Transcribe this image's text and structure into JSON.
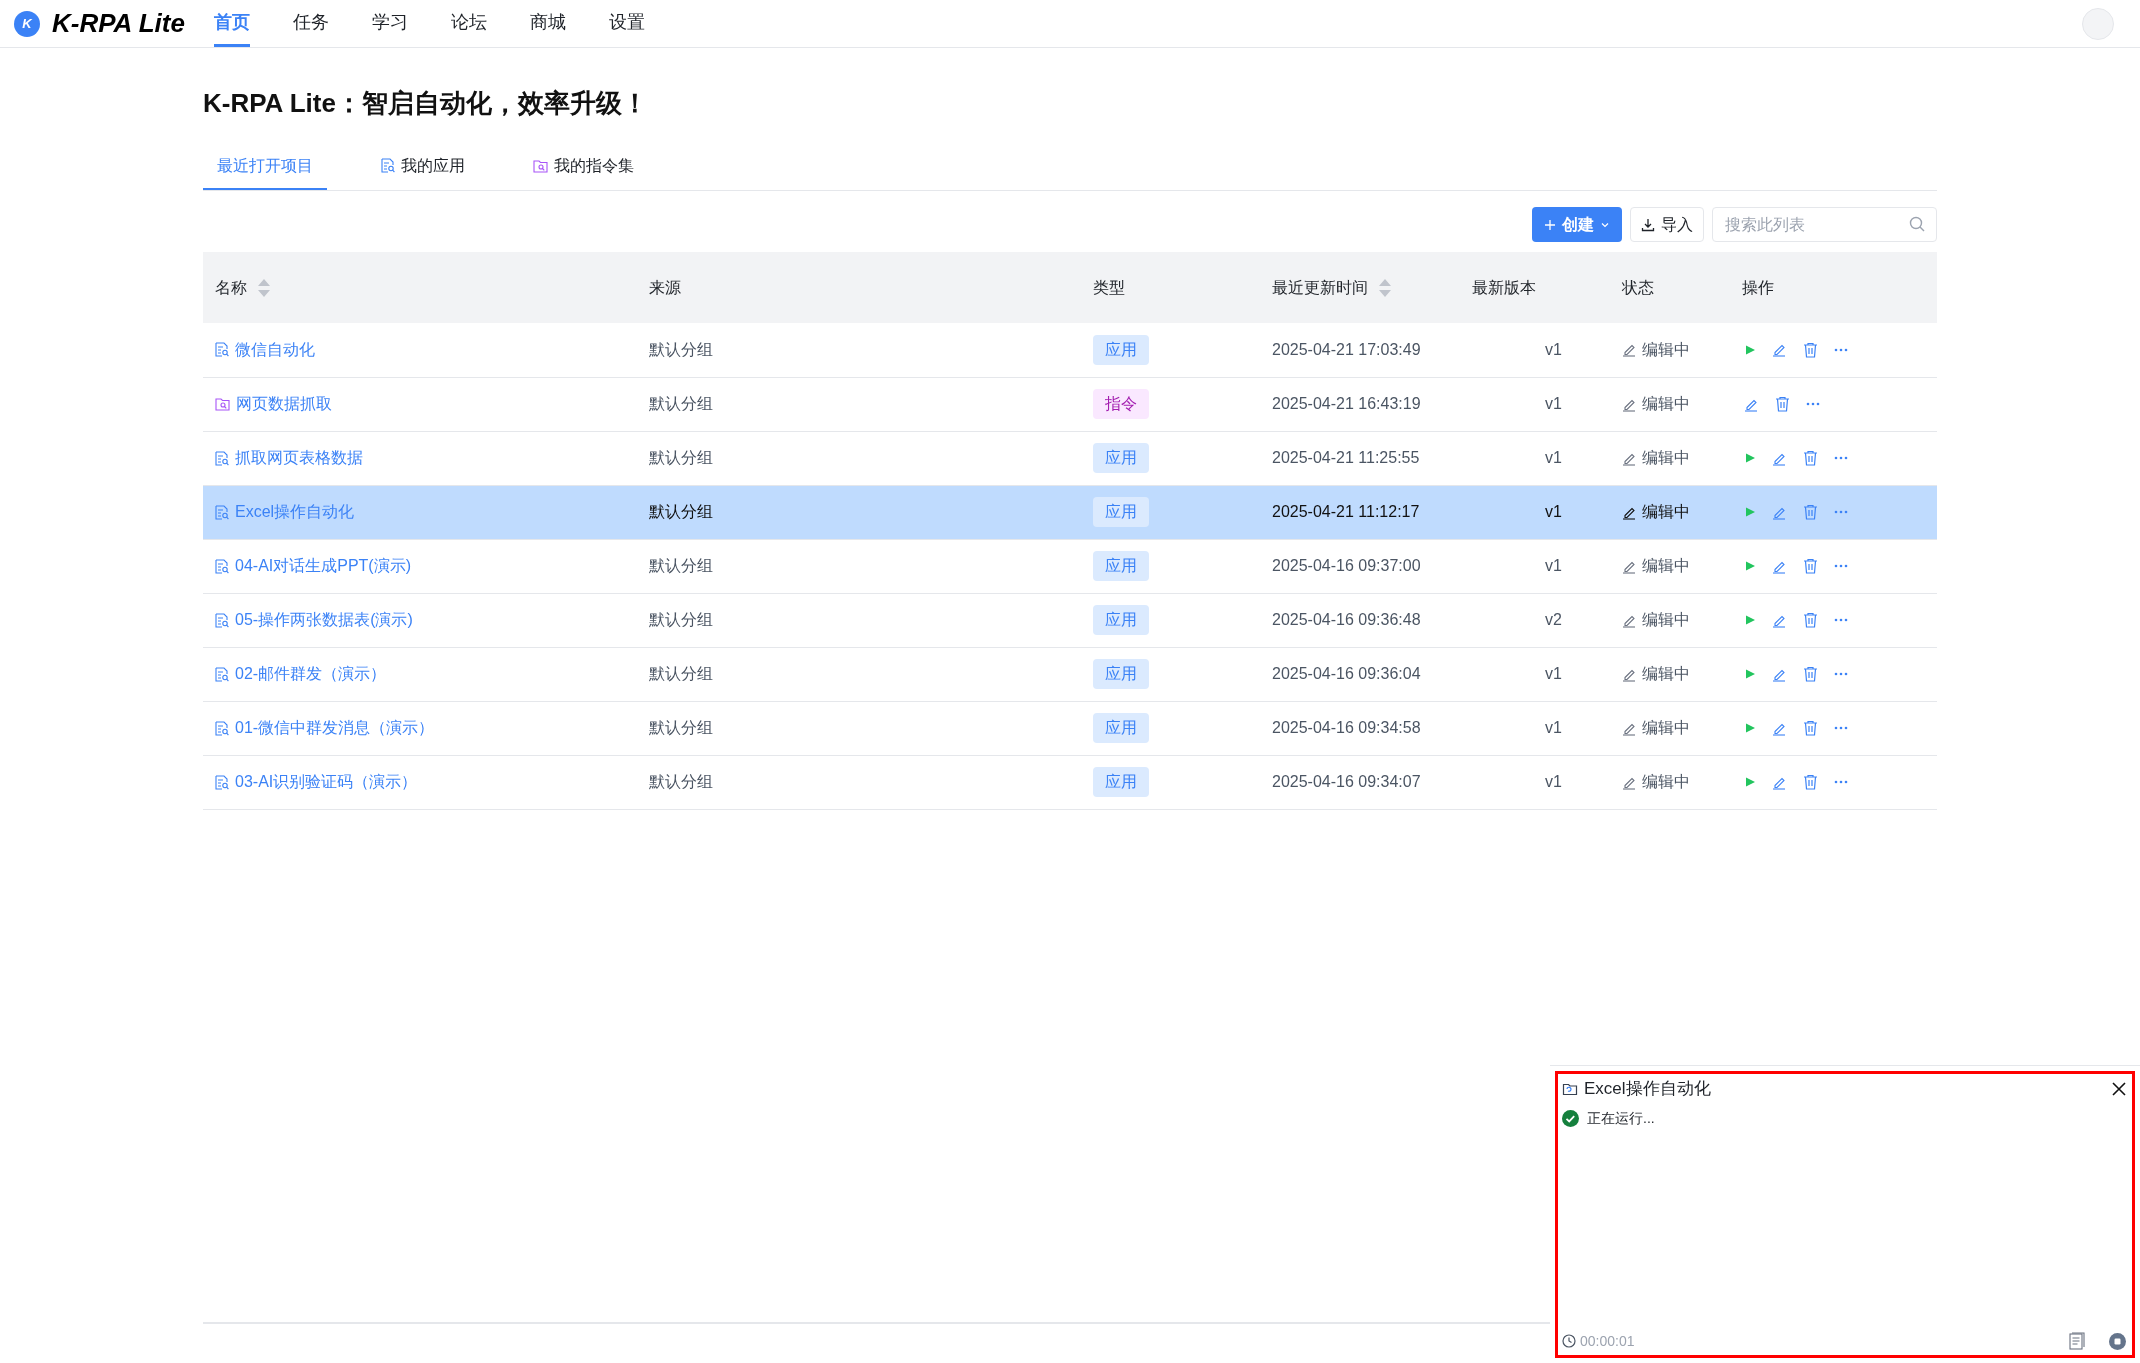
{
  "app": {
    "logo_letter": "K",
    "name": "K-RPA Lite"
  },
  "nav": [
    {
      "label": "首页",
      "selected": true
    },
    {
      "label": "任务",
      "selected": false
    },
    {
      "label": "学习",
      "selected": false
    },
    {
      "label": "论坛",
      "selected": false
    },
    {
      "label": "商城",
      "selected": false
    },
    {
      "label": "设置",
      "selected": false
    }
  ],
  "page_title": "K-RPA Lite：智启自动化，效率升级！",
  "tabs": [
    {
      "label": "最近打开项目",
      "kind": "recent",
      "selected": true
    },
    {
      "label": "我的应用",
      "kind": "app",
      "selected": false
    },
    {
      "label": "我的指令集",
      "kind": "command",
      "selected": false
    }
  ],
  "toolbar": {
    "create_button": "创建",
    "import_button": "导入",
    "search": {
      "placeholder": "搜索此列表"
    }
  },
  "table": {
    "columns": [
      {
        "label": "名称",
        "sortable": true
      },
      {
        "label": "来源",
        "sortable": false
      },
      {
        "label": "类型",
        "sortable": false
      },
      {
        "label": "最近更新时间",
        "sortable": true
      },
      {
        "label": "最新版本",
        "sortable": false
      },
      {
        "label": "状态",
        "sortable": false
      },
      {
        "label": "操作",
        "sortable": false
      }
    ],
    "rows": [
      {
        "name": "微信自动化",
        "kind": "app",
        "source": "默认分组",
        "type": "应用",
        "updated": "2025-04-21 17:03:49",
        "version": "v1",
        "status": "编辑中",
        "selected": false
      },
      {
        "name": "网页数据抓取",
        "kind": "command",
        "source": "默认分组",
        "type": "指令",
        "updated": "2025-04-21 16:43:19",
        "version": "v1",
        "status": "编辑中",
        "selected": false
      },
      {
        "name": "抓取网页表格数据",
        "kind": "app",
        "source": "默认分组",
        "type": "应用",
        "updated": "2025-04-21 11:25:55",
        "version": "v1",
        "status": "编辑中",
        "selected": false
      },
      {
        "name": "Excel操作自动化",
        "kind": "app",
        "source": "默认分组",
        "type": "应用",
        "updated": "2025-04-21 11:12:17",
        "version": "v1",
        "status": "编辑中",
        "selected": true
      },
      {
        "name": "04-AI对话生成PPT(演示)",
        "kind": "app",
        "source": "默认分组",
        "type": "应用",
        "updated": "2025-04-16 09:37:00",
        "version": "v1",
        "status": "编辑中",
        "selected": false
      },
      {
        "name": "05-操作两张数据表(演示)",
        "kind": "app",
        "source": "默认分组",
        "type": "应用",
        "updated": "2025-04-16 09:36:48",
        "version": "v2",
        "status": "编辑中",
        "selected": false
      },
      {
        "name": "02-邮件群发（演示）",
        "kind": "app",
        "source": "默认分组",
        "type": "应用",
        "updated": "2025-04-16 09:36:04",
        "version": "v1",
        "status": "编辑中",
        "selected": false
      },
      {
        "name": "01-微信中群发消息（演示）",
        "kind": "app",
        "source": "默认分组",
        "type": "应用",
        "updated": "2025-04-16 09:34:58",
        "version": "v1",
        "status": "编辑中",
        "selected": false
      },
      {
        "name": "03-AI识别验证码（演示）",
        "kind": "app",
        "source": "默认分组",
        "type": "应用",
        "updated": "2025-04-16 09:34:07",
        "version": "v1",
        "status": "编辑中",
        "selected": false
      }
    ]
  },
  "run_panel": {
    "title": "Excel操作自动化",
    "status": "正在运行...",
    "elapsed": "00:00:01"
  }
}
